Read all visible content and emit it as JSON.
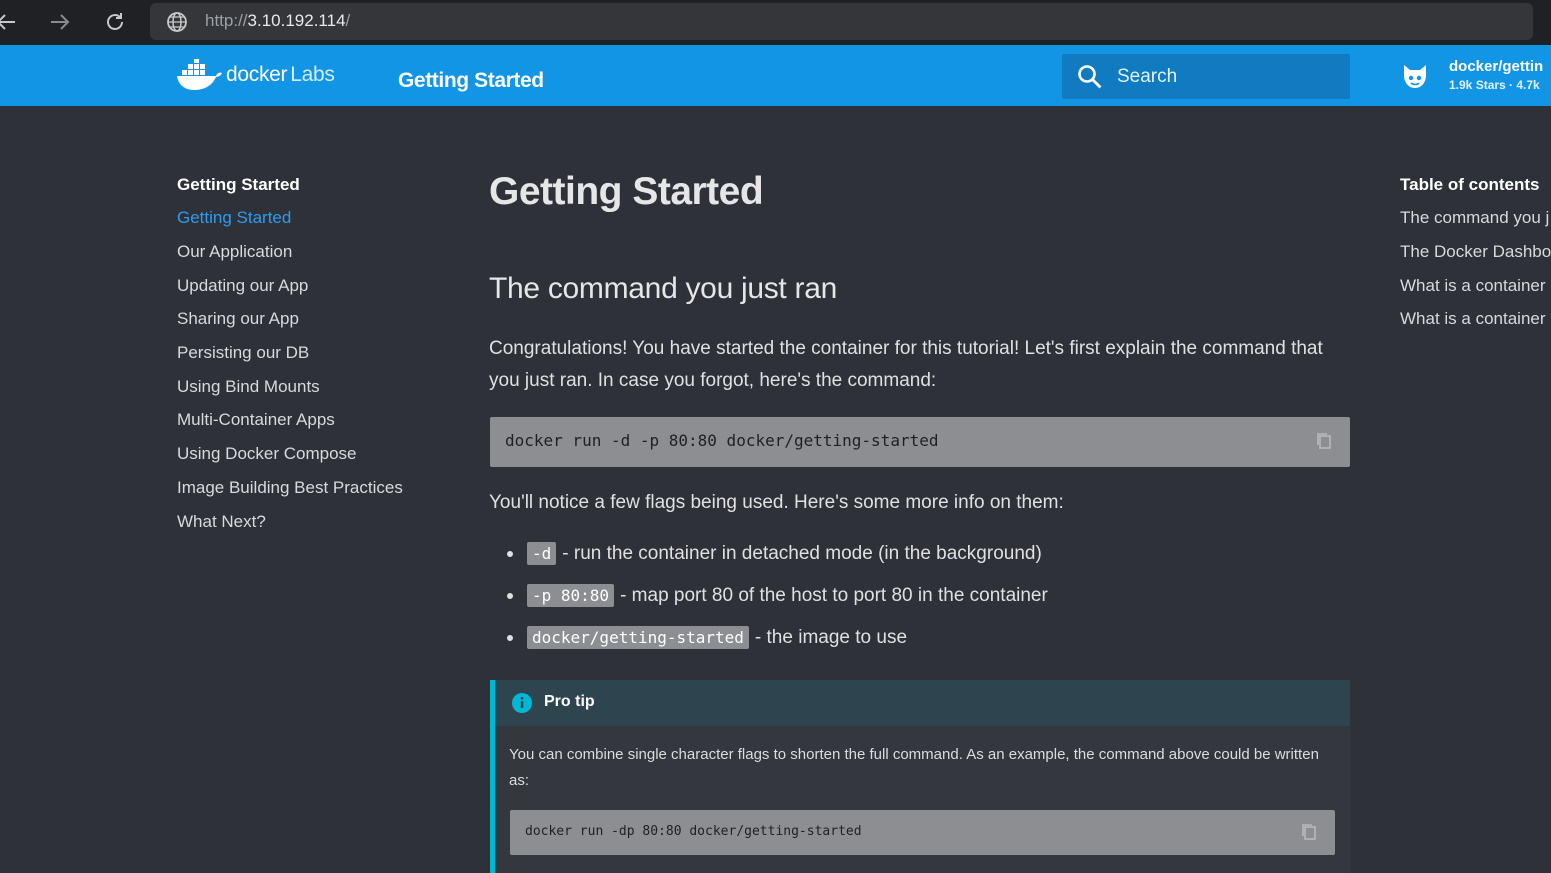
{
  "browser": {
    "url_scheme": "http://",
    "url_host": "3.10.192.114",
    "url_path": "/"
  },
  "header": {
    "logo_text": "docker",
    "logo_suffix": "Labs",
    "title": "Getting Started",
    "search_placeholder": "Search",
    "repo_name": "docker/gettin",
    "repo_stats": "1.9k Stars · 4.7k"
  },
  "sidebar": {
    "title": "Getting Started",
    "items": [
      {
        "label": "Getting Started",
        "active": true
      },
      {
        "label": "Our Application"
      },
      {
        "label": "Updating our App"
      },
      {
        "label": "Sharing our App"
      },
      {
        "label": "Persisting our DB"
      },
      {
        "label": "Using Bind Mounts"
      },
      {
        "label": "Multi-Container Apps"
      },
      {
        "label": "Using Docker Compose"
      },
      {
        "label": "Image Building Best Practices"
      },
      {
        "label": "What Next?"
      }
    ]
  },
  "toc": {
    "title": "Table of contents",
    "items": [
      "The command you j",
      "The Docker Dashbo",
      "What is a container",
      "What is a container"
    ]
  },
  "content": {
    "h1": "Getting Started",
    "h2": "The command you just ran",
    "p1": "Congratulations! You have started the container for this tutorial! Let's first explain the command that you just ran. In case you forgot, here's the command:",
    "code1": "docker run -d -p 80:80 docker/getting-started",
    "p2": "You'll notice a few flags being used. Here's some more info on them:",
    "bullets": [
      {
        "code": "-d",
        "text": "- run the container in detached mode (in the background)"
      },
      {
        "code": "-p 80:80",
        "text": "- map port 80 of the host to port 80 in the container"
      },
      {
        "code": "docker/getting-started",
        "text": "- the image to use"
      }
    ],
    "tip": {
      "title": "Pro tip",
      "body": "You can combine single character flags to shorten the full command. As an example, the command above could be written as:",
      "code": "docker run -dp 80:80 docker/getting-started"
    }
  }
}
